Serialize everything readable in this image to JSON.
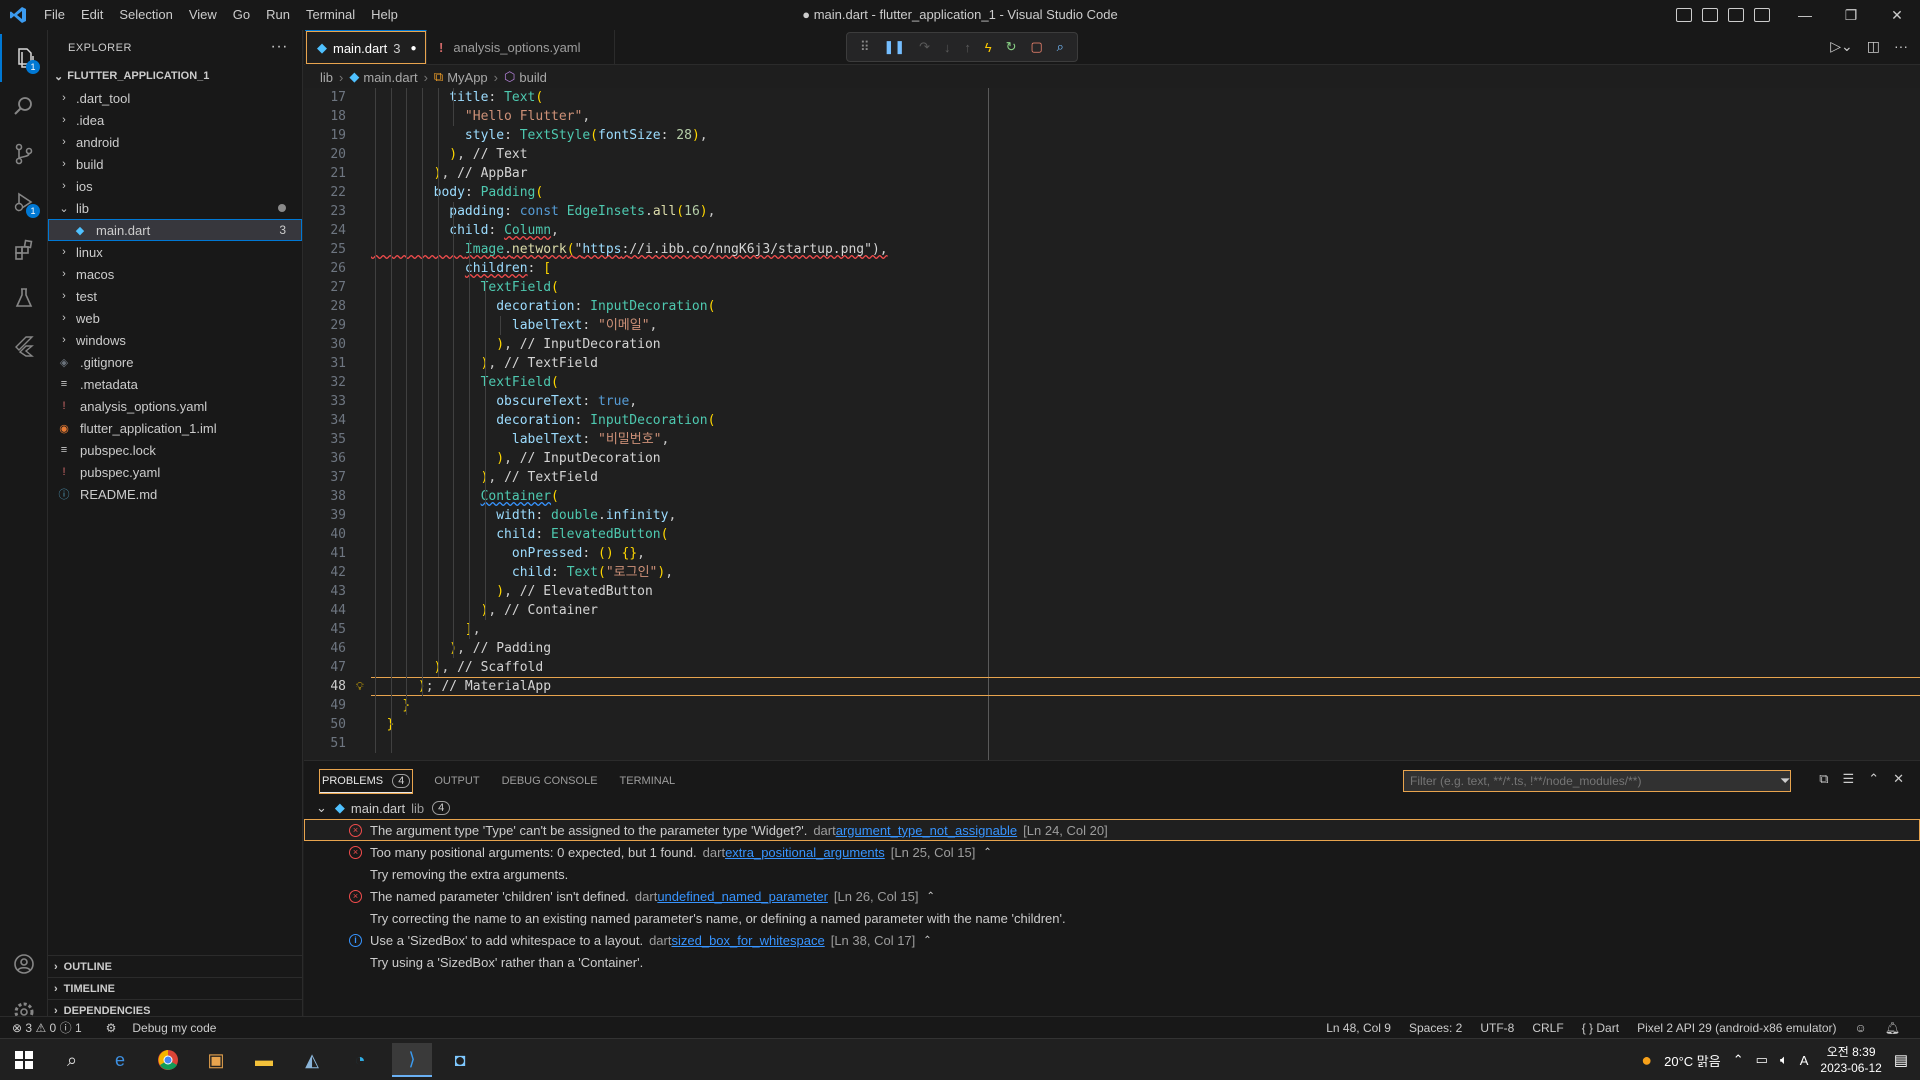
{
  "titlebar": {
    "title": "● main.dart - flutter_application_1 - Visual Studio Code",
    "menu": [
      "File",
      "Edit",
      "Selection",
      "View",
      "Go",
      "Run",
      "Terminal",
      "Help"
    ]
  },
  "activity": {
    "run_badge": "1",
    "source_badge": "",
    "explorer_badge": "1"
  },
  "sidebar": {
    "title": "EXPLORER",
    "project": "FLUTTER_APPLICATION_1",
    "items": [
      {
        "label": ".dart_tool",
        "type": "folder"
      },
      {
        "label": ".idea",
        "type": "folder"
      },
      {
        "label": "android",
        "type": "folder"
      },
      {
        "label": "build",
        "type": "folder"
      },
      {
        "label": "ios",
        "type": "folder"
      },
      {
        "label": "lib",
        "type": "folder-open"
      },
      {
        "label": "main.dart",
        "type": "dart",
        "count": "3"
      },
      {
        "label": "linux",
        "type": "folder"
      },
      {
        "label": "macos",
        "type": "folder"
      },
      {
        "label": "test",
        "type": "folder"
      },
      {
        "label": "web",
        "type": "folder"
      },
      {
        "label": "windows",
        "type": "folder"
      },
      {
        "label": ".gitignore",
        "type": "git"
      },
      {
        "label": ".metadata",
        "type": "file"
      },
      {
        "label": "analysis_options.yaml",
        "type": "yaml"
      },
      {
        "label": "flutter_application_1.iml",
        "type": "rss"
      },
      {
        "label": "pubspec.lock",
        "type": "lock"
      },
      {
        "label": "pubspec.yaml",
        "type": "yaml"
      },
      {
        "label": "README.md",
        "type": "info"
      }
    ],
    "sections": [
      "OUTLINE",
      "TIMELINE",
      "DEPENDENCIES"
    ]
  },
  "tabs": [
    {
      "label": "main.dart",
      "count": "3"
    },
    {
      "label": "analysis_options.yaml"
    }
  ],
  "breadcrumb": [
    "lib",
    "main.dart",
    "MyApp",
    "build"
  ],
  "editor": {
    "current_line": 48,
    "lines": [
      {
        "n": "17",
        "code": "          title: Text("
      },
      {
        "n": "18",
        "code": "            \"Hello Flutter\","
      },
      {
        "n": "19",
        "code": "            style: TextStyle(fontSize: 28),"
      },
      {
        "n": "20",
        "code": "          ), // Text"
      },
      {
        "n": "21",
        "code": "        ), // AppBar"
      },
      {
        "n": "22",
        "code": "        body: Padding("
      },
      {
        "n": "23",
        "code": "          padding: const EdgeInsets.all(16),"
      },
      {
        "n": "24",
        "code": "          child: Column,"
      },
      {
        "n": "25",
        "code": "            Image.network(\"https://i.ibb.co/nngK6j3/startup.png\"),"
      },
      {
        "n": "26",
        "code": "            children: ["
      },
      {
        "n": "27",
        "code": "              TextField("
      },
      {
        "n": "28",
        "code": "                decoration: InputDecoration("
      },
      {
        "n": "29",
        "code": "                  labelText: \"이메일\","
      },
      {
        "n": "30",
        "code": "                ), // InputDecoration"
      },
      {
        "n": "31",
        "code": "              ), // TextField"
      },
      {
        "n": "32",
        "code": "              TextField("
      },
      {
        "n": "33",
        "code": "                obscureText: true,"
      },
      {
        "n": "34",
        "code": "                decoration: InputDecoration("
      },
      {
        "n": "35",
        "code": "                  labelText: \"비밀번호\","
      },
      {
        "n": "36",
        "code": "                ), // InputDecoration"
      },
      {
        "n": "37",
        "code": "              ), // TextField"
      },
      {
        "n": "38",
        "code": "              Container("
      },
      {
        "n": "39",
        "code": "                width: double.infinity,"
      },
      {
        "n": "40",
        "code": "                child: ElevatedButton("
      },
      {
        "n": "41",
        "code": "                  onPressed: () {},"
      },
      {
        "n": "42",
        "code": "                  child: Text(\"로그인\"),"
      },
      {
        "n": "43",
        "code": "                ), // ElevatedButton"
      },
      {
        "n": "44",
        "code": "              ), // Container"
      },
      {
        "n": "45",
        "code": "            ],"
      },
      {
        "n": "46",
        "code": "          ), // Padding"
      },
      {
        "n": "47",
        "code": "        ), // Scaffold"
      },
      {
        "n": "48",
        "code": "      ); // MaterialApp"
      },
      {
        "n": "49",
        "code": "    }"
      },
      {
        "n": "50",
        "code": "  }"
      },
      {
        "n": "51",
        "code": ""
      }
    ]
  },
  "panel": {
    "tabs": [
      "PROBLEMS",
      "OUTPUT",
      "DEBUG CONSOLE",
      "TERMINAL"
    ],
    "problems_count": "4",
    "filter_placeholder": "Filter (e.g. text, **/*.ts, !**/node_modules/**)",
    "file": {
      "name": "main.dart",
      "dir": "lib",
      "count": "4"
    },
    "problems": [
      {
        "severity": "error",
        "message": "The argument type 'Type' can't be assigned to the parameter type 'Widget?'.",
        "source": "dart",
        "code": "argument_type_not_assignable",
        "loc": "[Ln 24, Col 20]",
        "hint": ""
      },
      {
        "severity": "error",
        "message": "Too many positional arguments: 0 expected, but 1 found.",
        "source": "dart",
        "code": "extra_positional_arguments",
        "loc": "[Ln 25, Col 15]",
        "hint": "Try removing the extra arguments."
      },
      {
        "severity": "error",
        "message": "The named parameter 'children' isn't defined.",
        "source": "dart",
        "code": "undefined_named_parameter",
        "loc": "[Ln 26, Col 15]",
        "hint": "Try correcting the name to an existing named parameter's name, or defining a named parameter with the name 'children'."
      },
      {
        "severity": "info",
        "message": "Use a 'SizedBox' to add whitespace to a layout.",
        "source": "dart",
        "code": "sized_box_for_whitespace",
        "loc": "[Ln 38, Col 17]",
        "hint": "Try using a 'SizedBox' rather than a 'Container'."
      }
    ]
  },
  "statusbar": {
    "errors": "3",
    "warnings": "0",
    "infos": "1",
    "debug": "Debug my code",
    "position": "Ln 48, Col 9",
    "spaces": "Spaces: 2",
    "encoding": "UTF-8",
    "eol": "CRLF",
    "language": "Dart",
    "device": "Pixel 2 API 29 (android-x86 emulator)"
  },
  "taskbar": {
    "weather": "20°C 맑음",
    "time": "오전 8:39",
    "date": "2023-06-12",
    "ime": "A"
  },
  "colors": {
    "accent": "#0078d4",
    "error": "#f14c4c",
    "info": "#3794ff",
    "focus": "#e8a44e"
  }
}
